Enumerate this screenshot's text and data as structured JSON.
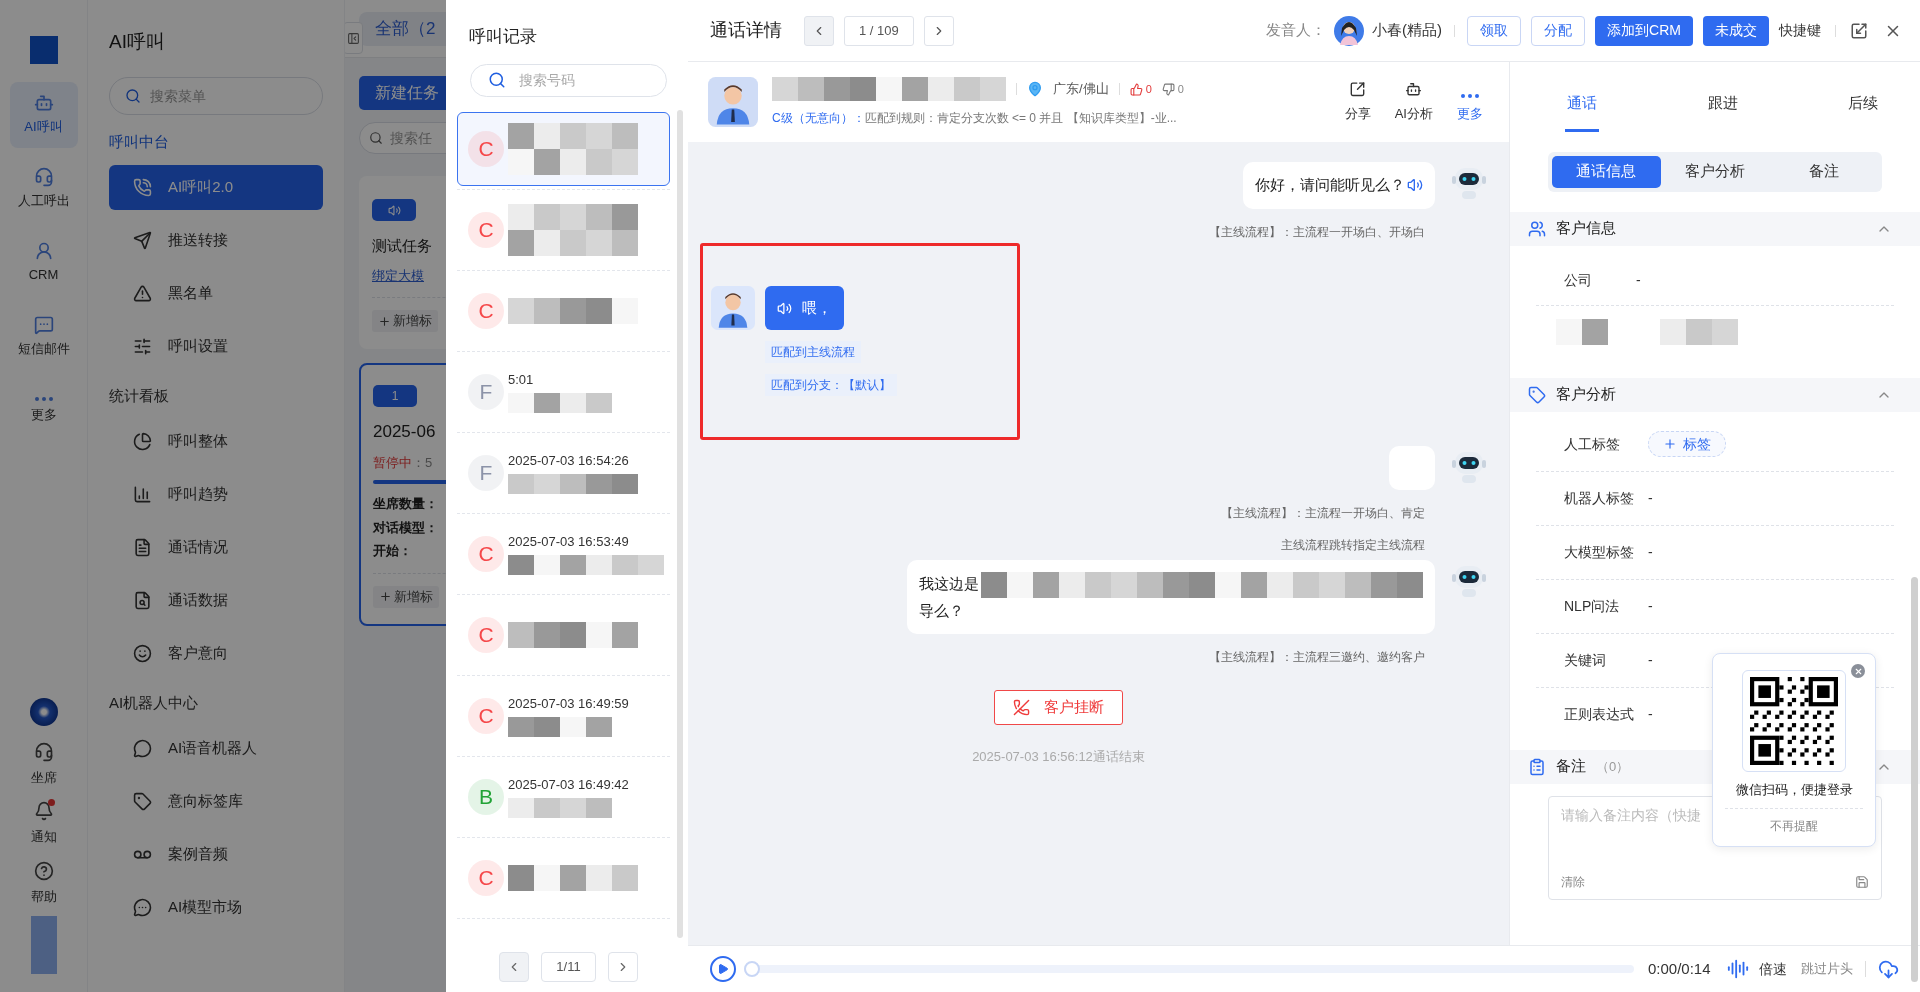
{
  "rail": {
    "items": [
      {
        "label": "AI呼叫",
        "selected": true
      },
      {
        "label": "人工呼出",
        "selected": false
      },
      {
        "label": "CRM",
        "selected": false
      },
      {
        "label": "短信邮件",
        "selected": false
      },
      {
        "label": "更多",
        "selected": false
      }
    ],
    "bottom": [
      {
        "label": "坐席",
        "badge": false
      },
      {
        "label": "通知",
        "badge": true
      },
      {
        "label": "帮助",
        "badge": false
      }
    ]
  },
  "menu": {
    "title": "AI呼叫",
    "search_placeholder": "搜索菜单",
    "sections": [
      {
        "title": "呼叫中台",
        "active": true,
        "items": [
          {
            "label": "AI呼叫2.0",
            "selected": true
          },
          {
            "label": "推送转接",
            "selected": false
          },
          {
            "label": "黑名单",
            "selected": false
          },
          {
            "label": "呼叫设置",
            "selected": false
          }
        ]
      },
      {
        "title": "统计看板",
        "active": false,
        "items": [
          {
            "label": "呼叫整体",
            "selected": false
          },
          {
            "label": "呼叫趋势",
            "selected": false
          },
          {
            "label": "通话情况",
            "selected": false
          },
          {
            "label": "通话数据",
            "selected": false
          },
          {
            "label": "客户意向",
            "selected": false
          }
        ]
      },
      {
        "title": "AI机器人中心",
        "active": false,
        "items": [
          {
            "label": "AI语音机器人",
            "selected": false
          },
          {
            "label": "意向标签库",
            "selected": false
          },
          {
            "label": "案例音频",
            "selected": false
          },
          {
            "label": "AI模型市场",
            "selected": false
          }
        ]
      }
    ]
  },
  "tasks": {
    "tab": "全部（2",
    "new_button": "新建任务",
    "search_placeholder": "搜索任",
    "cards": [
      {
        "kind": "bound",
        "title": "测试任务",
        "link": "绑定大模",
        "add_tag": "新增标",
        "selected": false
      },
      {
        "kind": "running",
        "badge": "1",
        "title": "2025-06",
        "status": "暂停中",
        "status_value": "：5",
        "fields": [
          "坐席数量：",
          "对话模型：",
          "开始："
        ],
        "add_tag": "新增标",
        "selected": true
      }
    ]
  },
  "calls": {
    "title": "呼叫记录",
    "search_placeholder": "搜索号码",
    "pager": "1/11",
    "items": [
      {
        "grade": "C",
        "color": "#f5484a",
        "selected": true
      },
      {
        "grade": "C",
        "color": "#f5484a",
        "selected": false
      },
      {
        "grade": "C",
        "color": "#f5484a",
        "selected": false
      },
      {
        "grade": "F",
        "color": "#8c93a8",
        "time": "5:01",
        "selected": false
      },
      {
        "grade": "F",
        "color": "#8c93a8",
        "time": "2025-07-03 16:54:26",
        "selected": false
      },
      {
        "grade": "C",
        "color": "#f5484a",
        "time": "2025-07-03 16:53:49",
        "selected": false
      },
      {
        "grade": "C",
        "color": "#f5484a",
        "selected": false
      },
      {
        "grade": "C",
        "color": "#f5484a",
        "time": "2025-07-03 16:49:59",
        "selected": false
      },
      {
        "grade": "B",
        "color": "#21a336",
        "time": "2025-07-03 16:49:42",
        "selected": false
      },
      {
        "grade": "C",
        "color": "#f5484a",
        "selected": false
      }
    ]
  },
  "detail": {
    "title": "通话详情",
    "pager": "1 / 109",
    "speaker_label": "发音人：",
    "speaker": "小春(精品)",
    "shortcut": "快捷键",
    "buttons": [
      {
        "label": "领取",
        "kind": "outline"
      },
      {
        "label": "分配",
        "kind": "outline"
      },
      {
        "label": "添加到CRM",
        "kind": "primary"
      },
      {
        "label": "未成交",
        "kind": "primary"
      }
    ]
  },
  "customer": {
    "location": "广东/佛山",
    "likes": "0",
    "dislikes": "0",
    "grade": "C级（无意向）：",
    "rule": "匹配到规则：肯定分支次数 <= 0 并且 【知识库类型】-业...",
    "actions": [
      {
        "label": "分享",
        "kind": "share"
      },
      {
        "label": "AI分析",
        "kind": "ai"
      },
      {
        "label": "更多",
        "kind": "more"
      }
    ]
  },
  "messages": [
    {
      "kind": "bot",
      "text": "你好，请问能听见么？",
      "notes": [
        "【主线流程】：主流程一开场白、开场白"
      ]
    },
    {
      "kind": "customer",
      "text": "喂，",
      "highlighted": true,
      "matches": [
        "匹配到主线流程",
        "匹配到分支：【默认】"
      ]
    },
    {
      "kind": "bot",
      "notes": [
        "【主线流程】：主流程一开场白、肯定",
        "主线流程跳转指定主线流程"
      ]
    },
    {
      "kind": "bot",
      "text": "我这边是",
      "continuation": "导么？",
      "redacted": true,
      "notes": [
        "【主线流程】：主流程三邀约、邀约客户"
      ]
    },
    {
      "kind": "hangup",
      "text": "客户挂断"
    },
    {
      "kind": "end",
      "text": "2025-07-03 16:56:12通话结束"
    }
  ],
  "player": {
    "time": "0:00/0:14",
    "level": 0,
    "speed": "倍速",
    "skip": "跳过片头"
  },
  "side": {
    "tabs": [
      {
        "label": "通话",
        "selected": true
      },
      {
        "label": "跟进",
        "selected": false
      },
      {
        "label": "后续",
        "selected": false
      }
    ],
    "segments": [
      {
        "label": "通话信息",
        "selected": true
      },
      {
        "label": "客户分析",
        "selected": false
      },
      {
        "label": "备注",
        "selected": false
      }
    ],
    "sections": [
      {
        "kind": "info",
        "title": "客户信息",
        "expanded": true,
        "rows": [
          {
            "label": "公司",
            "value": "-"
          }
        ]
      },
      {
        "kind": "analysis",
        "title": "客户分析",
        "expanded": true,
        "rows": [
          {
            "label": "人工标签",
            "kind": "tag",
            "value": "标签"
          },
          {
            "label": "机器人标签",
            "kind": "text",
            "value": "-"
          },
          {
            "label": "大模型标签",
            "kind": "text",
            "value": "-"
          },
          {
            "label": "NLP问法",
            "kind": "text",
            "value": "-"
          },
          {
            "label": "关键词",
            "kind": "text",
            "value": "-"
          },
          {
            "label": "正则表达式",
            "kind": "text",
            "value": "-"
          }
        ]
      },
      {
        "kind": "note",
        "title": "备注",
        "count": "（0）",
        "expanded": true,
        "placeholder": "请输入备注内容（快捷",
        "clear": "清除"
      }
    ]
  },
  "popup": {
    "caption": "微信扫码，便捷登录",
    "dismiss": "不再提醒"
  }
}
